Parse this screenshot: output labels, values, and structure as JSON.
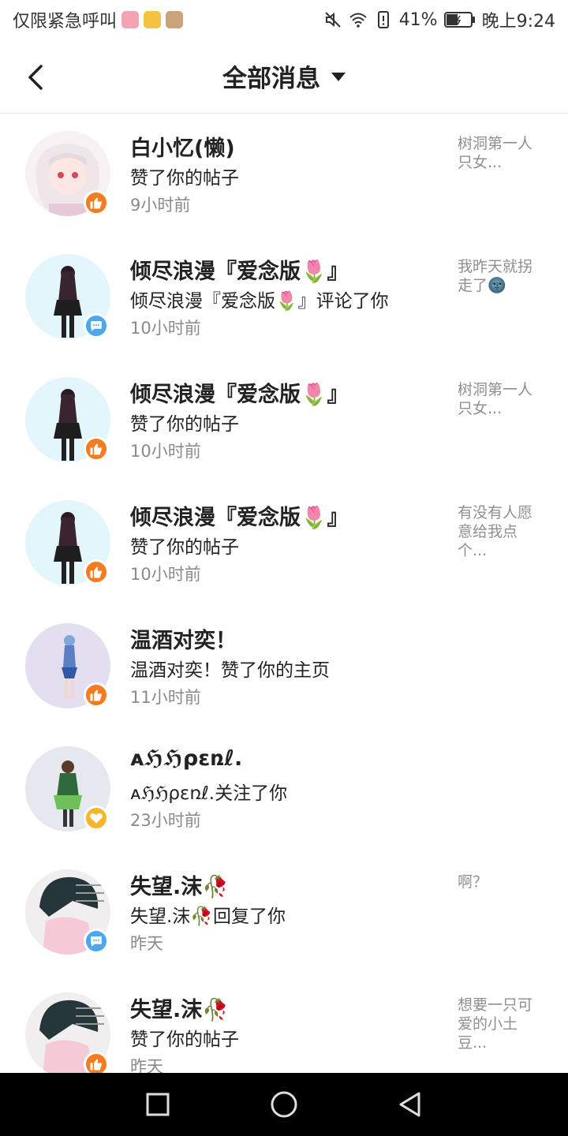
{
  "status_bar": {
    "carrier_text": "仅限紧急呼叫",
    "battery": "41%",
    "time": "晚上9:24"
  },
  "header": {
    "title": "全部消息"
  },
  "messages": [
    {
      "name": "白小忆(懒)",
      "action": "赞了你的帖子",
      "time": "9小时前",
      "preview": "树洞第一人只女...",
      "badge": "like-icon"
    },
    {
      "name": "倾尽浪漫『爱念版🌷』",
      "action": "倾尽浪漫『爱念版🌷』评论了你",
      "time": "10小时前",
      "preview": "我昨天就拐走了🌚",
      "badge": "comment-icon"
    },
    {
      "name": "倾尽浪漫『爱念版🌷』",
      "action": "赞了你的帖子",
      "time": "10小时前",
      "preview": "树洞第一人只女...",
      "badge": "like-icon"
    },
    {
      "name": "倾尽浪漫『爱念版🌷』",
      "action": "赞了你的帖子",
      "time": "10小时前",
      "preview": "有没有人愿意给我点个...",
      "badge": "like-icon"
    },
    {
      "name": "温酒对奕！",
      "action": "温酒对奕！赞了你的主页",
      "time": "11小时前",
      "preview": "",
      "badge": "like-icon"
    },
    {
      "name": "ᴀℌℌρεռℓ.",
      "action": "ᴀℌℌρεռℓ.关注了你",
      "time": "23小时前",
      "preview": "",
      "badge": "heart-icon"
    },
    {
      "name": "失望.沫🥀",
      "action": "失望.沫🥀回复了你",
      "time": "昨天",
      "preview": "啊？",
      "badge": "comment-icon"
    },
    {
      "name": "失望.沫🥀",
      "action": "赞了你的帖子",
      "time": "昨天",
      "preview": "想要一只可爱的小土豆...",
      "badge": "like-icon"
    }
  ],
  "colors": {
    "like_badge": "#f47b20",
    "comment_badge": "#4aa9ee",
    "follow_badge": "#f7b52c"
  }
}
